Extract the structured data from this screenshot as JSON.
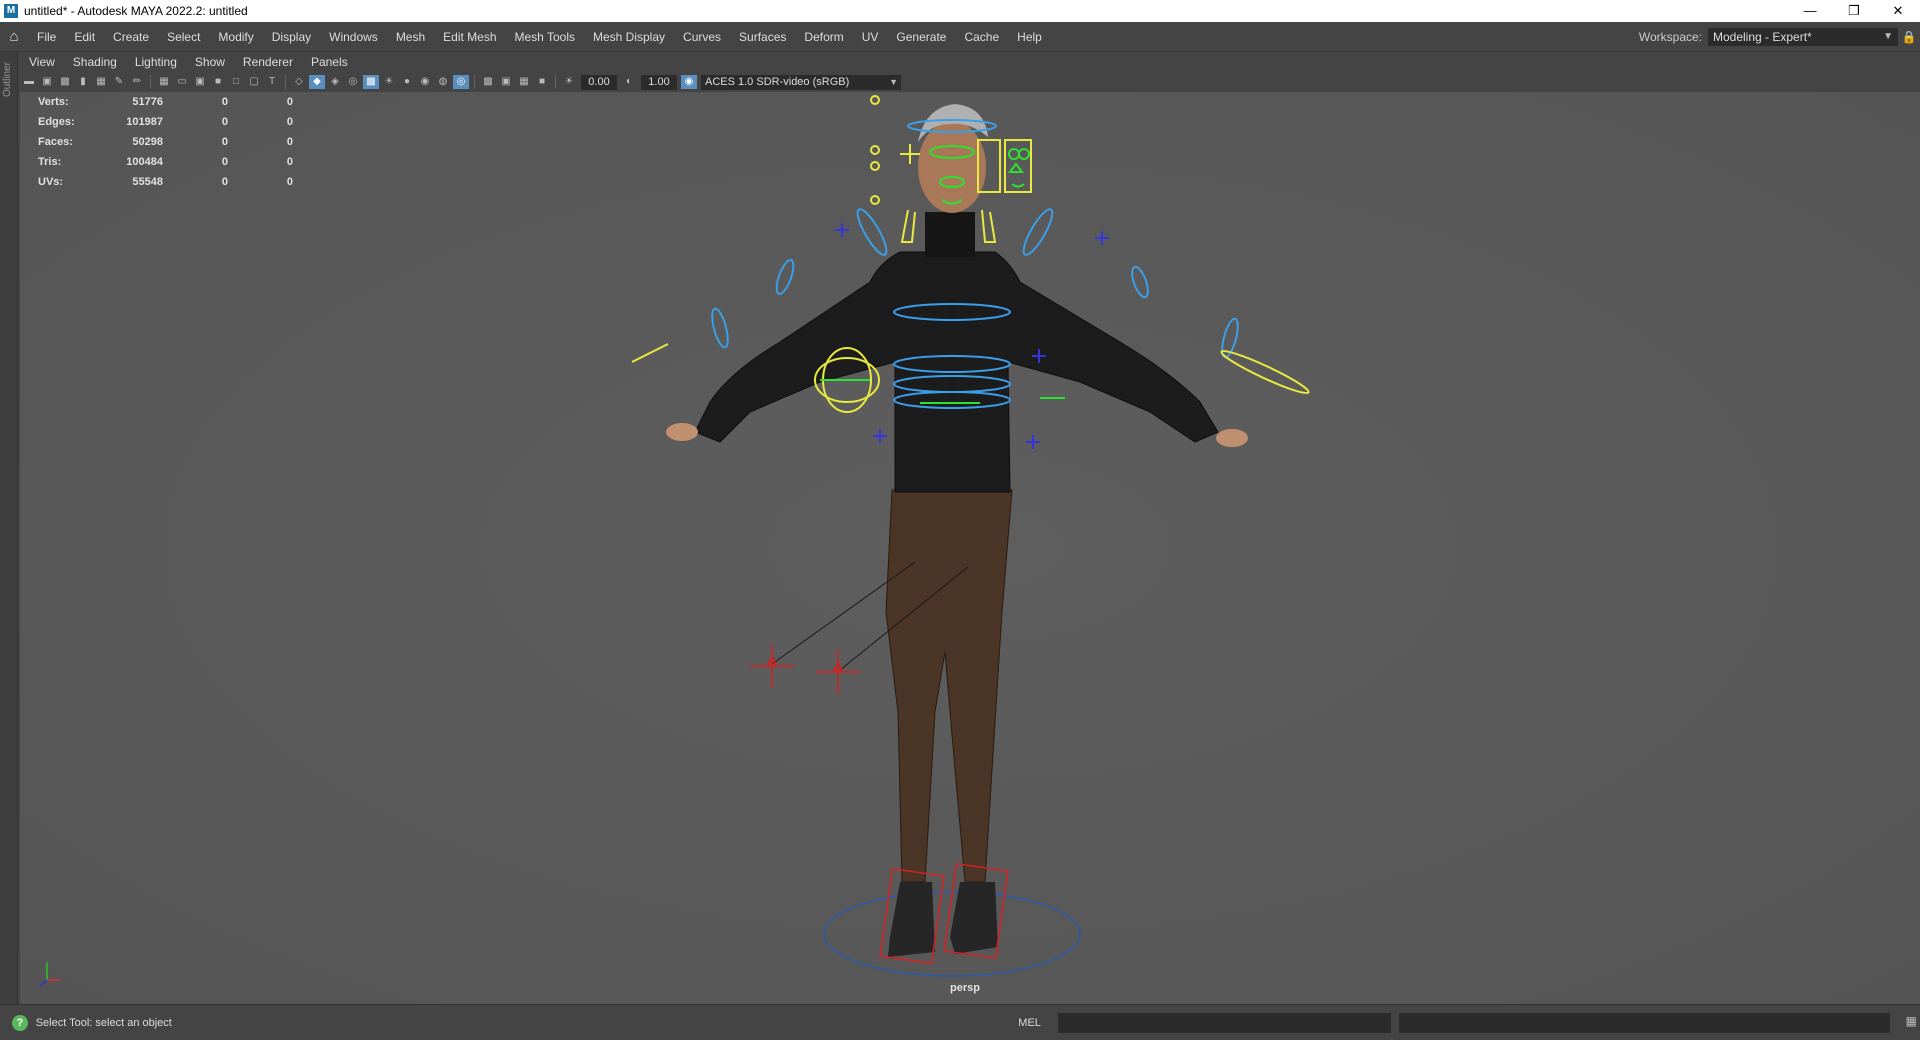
{
  "window": {
    "app_icon": "maya-logo-icon",
    "title": "untitled* - Autodesk MAYA 2022.2: untitled",
    "controls": [
      "minimize-icon",
      "restore-icon",
      "close-icon"
    ]
  },
  "menubar": {
    "items": [
      "File",
      "Edit",
      "Create",
      "Select",
      "Modify",
      "Display",
      "Windows",
      "Mesh",
      "Edit Mesh",
      "Mesh Tools",
      "Mesh Display",
      "Curves",
      "Surfaces",
      "Deform",
      "UV",
      "Generate",
      "Cache",
      "Help"
    ],
    "workspace_label": "Workspace:",
    "workspace_value": "Modeling - Expert*"
  },
  "side_panel": {
    "outliner_label": "Outliner"
  },
  "panel_menu": {
    "items": [
      "View",
      "Shading",
      "Lighting",
      "Show",
      "Renderer",
      "Panels"
    ]
  },
  "panel_toolbar": {
    "exposure": "0.00",
    "gamma": "1.00",
    "color_space": "ACES 1.0 SDR-video (sRGB)"
  },
  "hud": {
    "rows": [
      {
        "label": "Verts:",
        "value": "51776",
        "sel": "0",
        "comp": "0"
      },
      {
        "label": "Edges:",
        "value": "101987",
        "sel": "0",
        "comp": "0"
      },
      {
        "label": "Faces:",
        "value": "50298",
        "sel": "0",
        "comp": "0"
      },
      {
        "label": "Tris:",
        "value": "100484",
        "sel": "0",
        "comp": "0"
      },
      {
        "label": "UVs:",
        "value": "55548",
        "sel": "0",
        "comp": "0"
      }
    ]
  },
  "viewport": {
    "camera": "persp"
  },
  "statusbar": {
    "help_text": "Select Tool: select an object",
    "command_language": "MEL"
  }
}
